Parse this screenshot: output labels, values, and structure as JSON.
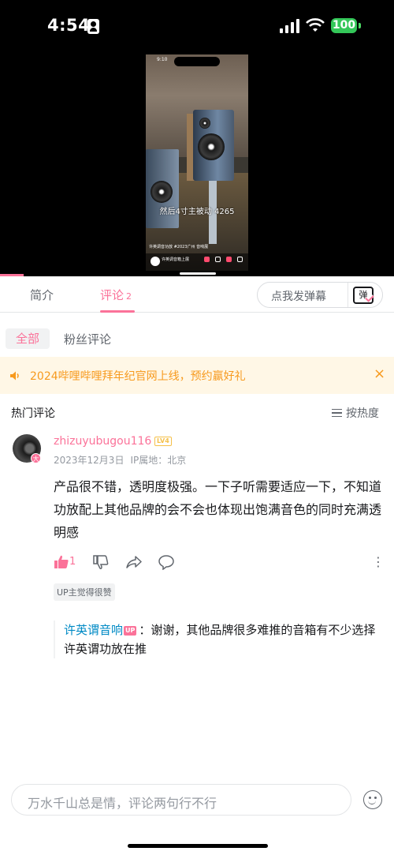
{
  "status_bar": {
    "time": "4:54",
    "battery": "100"
  },
  "video": {
    "mini_time": "9:10",
    "subtitle": "然后4寸主被动 4265",
    "caption_line": "许英调音功放 #2023广州 音响展",
    "channel_name": "许英调音箱上展"
  },
  "tabs": {
    "intro": "简介",
    "comments": "评论",
    "comments_count": "2",
    "danmaku_button": "点我发弹幕",
    "danmaku_icon_char": "弹"
  },
  "filters": {
    "all": "全部",
    "fans": "粉丝评论"
  },
  "notice": {
    "text": "2024哔哩哔哩拜年纪官网上线，预约赢好礼",
    "close": "×"
  },
  "comments_section": {
    "title": "热门评论",
    "sort_label": "按热度"
  },
  "comment": {
    "avatar_badge": "大",
    "username": "zhizuyubugou116",
    "level": "LV4",
    "date": "2023年12月3日",
    "ip": "IP属地：北京",
    "content": "产品很不错，透明度极强。一下子听需要适应一下，不知道功放配上其他品牌的会不会也体现出饱满音色的同时充满透明感",
    "like_count": "1",
    "more": "⋮",
    "up_liked": "UP主觉得很赞"
  },
  "reply": {
    "name": "许英谓音响",
    "up_tag": "UP",
    "text": "：谢谢，其他品牌很多难推的音箱有不少选择许英谓功放在推"
  },
  "bottom": {
    "input_placeholder": "万水千山总是情，评论两句行不行"
  },
  "colors": {
    "brand_pink": "#fb7299",
    "notice_orange": "#f79a1e",
    "reply_link": "#008ac5"
  }
}
